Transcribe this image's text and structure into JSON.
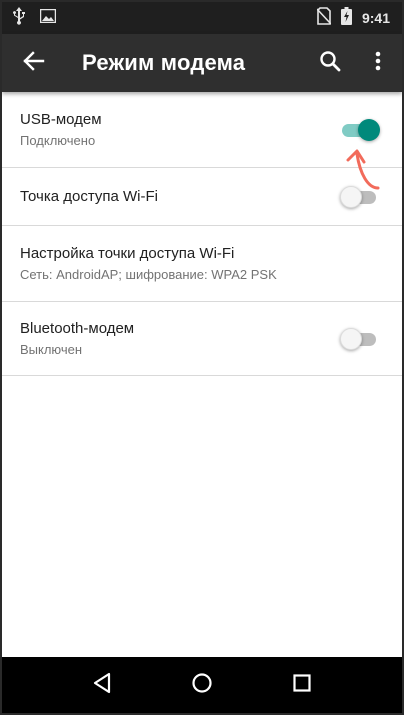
{
  "status_bar": {
    "time": "9:41",
    "icons": [
      "usb-icon",
      "image-icon",
      "no-sim-icon",
      "battery-charging-icon"
    ]
  },
  "app_bar": {
    "title": "Режим модема",
    "back_icon": "arrow-back-icon",
    "search_icon": "search-icon",
    "menu_icon": "more-vert-icon"
  },
  "settings": [
    {
      "title": "USB-модем",
      "subtitle": "Подключено",
      "switch": "on"
    },
    {
      "title": "Точка доступа Wi-Fi",
      "switch": "off"
    },
    {
      "title": "Настройка точки доступа Wi-Fi",
      "subtitle": "Сеть: AndroidAP; шифрование: WPA2 PSK"
    },
    {
      "title": "Bluetooth-модем",
      "subtitle": "Выключен",
      "switch": "off"
    }
  ],
  "nav_bar": {
    "icons": [
      "back-triangle-icon",
      "home-circle-icon",
      "recents-square-icon"
    ]
  },
  "colors": {
    "accent": "#00897b",
    "accent_track": "#80cbc4",
    "annotation_arrow": "#f26b5b",
    "app_bar": "#2f2f2f",
    "status_bar": "#1f1f1f"
  }
}
